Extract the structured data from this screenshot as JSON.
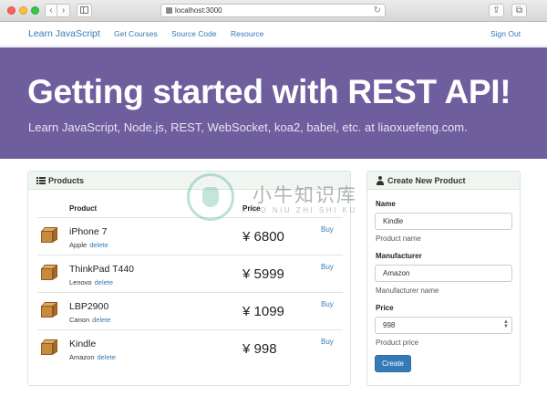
{
  "browser": {
    "url": "localhost:3000",
    "back_glyph": "‹",
    "forward_glyph": "›",
    "reload_glyph": "↻",
    "share_glyph": "⇪",
    "tabs_glyph": "⧉"
  },
  "navbar": {
    "brand": "Learn JavaScript",
    "links": [
      "Get Courses",
      "Source Code",
      "Resource"
    ],
    "signout": "Sign Out"
  },
  "hero": {
    "title": "Getting started with REST API!",
    "subtitle": "Learn JavaScript, Node.js, REST, WebSocket, koa2, babel, etc. at liaoxuefeng.com."
  },
  "products": {
    "heading": "Products",
    "columns": {
      "product": "Product",
      "price": "Price"
    },
    "delete_label": "delete",
    "buy_label": "Buy",
    "items": [
      {
        "name": "iPhone 7",
        "manufacturer": "Apple",
        "price": "¥ 6800"
      },
      {
        "name": "ThinkPad T440",
        "manufacturer": "Lenovo",
        "price": "¥ 5999"
      },
      {
        "name": "LBP2900",
        "manufacturer": "Canon",
        "price": "¥ 1099"
      },
      {
        "name": "Kindle",
        "manufacturer": "Amazon",
        "price": "¥ 998"
      }
    ]
  },
  "create_form": {
    "heading": "Create New Product",
    "name_label": "Name",
    "name_value": "Kindle",
    "name_help": "Product name",
    "manufacturer_label": "Manufacturer",
    "manufacturer_value": "Amazon",
    "manufacturer_help": "Manufacturer name",
    "price_label": "Price",
    "price_value": "998",
    "price_help": "Product price",
    "submit_label": "Create"
  },
  "watermark": {
    "cn": "小牛知识库",
    "en": "XIAO NIU ZHI SHI KU"
  },
  "colors": {
    "hero_bg": "#6e5e9e",
    "link": "#337ab7",
    "button": "#337ab7"
  }
}
